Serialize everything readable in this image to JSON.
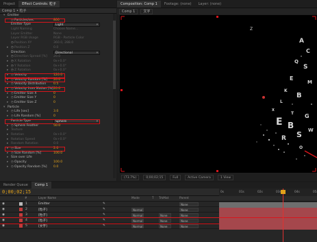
{
  "left_tabs": [
    "Project",
    "Effect Controls: 粒子"
  ],
  "fx_subtitle": "Comp 1 • 粒子",
  "fx_rows": [
    {
      "label": "Emitter",
      "indent": 1,
      "tri": "▾",
      "type": "section"
    },
    {
      "label": "Particles/sec",
      "indent": 2,
      "sw": true,
      "value": "800",
      "vc": "orange",
      "hl": true
    },
    {
      "label": "Emitter Type",
      "indent": 2,
      "value": "Light",
      "vc": "dd"
    },
    {
      "label": "Light Naming",
      "indent": 2,
      "dim": true,
      "value": "Choose Name...",
      "vc": "dim"
    },
    {
      "label": "Layer Emitter",
      "indent": 2,
      "dim": true,
      "value": "None",
      "vc": "dim"
    },
    {
      "label": "Layer RGB Usage",
      "indent": 2,
      "dim": true,
      "value": "RGB - Particle Color",
      "vc": "dim"
    },
    {
      "label": "Position XY",
      "indent": 2,
      "dim": true,
      "sw": true,
      "value": "360.0, 288.0",
      "vc": "dim"
    },
    {
      "label": "Position Z",
      "indent": 2,
      "dim": true,
      "tri": "▸",
      "sw": true,
      "value": "0.0",
      "vc": "dim"
    },
    {
      "label": "Direction",
      "indent": 2,
      "value": "Directional",
      "vc": "dd"
    },
    {
      "label": "Direction Spread [%]",
      "indent": 2,
      "dim": true,
      "tri": "▸",
      "sw": true,
      "value": "20.0",
      "vc": "dim"
    },
    {
      "label": "X Rotation",
      "indent": 2,
      "dim": true,
      "tri": "▸",
      "sw": true,
      "value": "0x+0.0°",
      "vc": "dim"
    },
    {
      "label": "Y Rotation",
      "indent": 2,
      "dim": true,
      "tri": "▸",
      "sw": true,
      "value": "0x+0.0°",
      "vc": "dim"
    },
    {
      "label": "Z Rotation",
      "indent": 2,
      "dim": true,
      "tri": "▸",
      "sw": true,
      "value": "0x+0.0°",
      "vc": "dim"
    },
    {
      "label": "Velocity",
      "indent": 2,
      "tri": "▸",
      "sw": true,
      "value": "120.0",
      "vc": "orange",
      "hl": true
    },
    {
      "label": "Velocity Random [%]",
      "indent": 2,
      "tri": "▸",
      "sw": true,
      "value": "20.0",
      "vc": "orange",
      "hl": true
    },
    {
      "label": "Velocity Distribution",
      "indent": 2,
      "tri": "▸",
      "sw": true,
      "value": "0.5",
      "vc": "orange"
    },
    {
      "label": "Velocity from Motion [%]",
      "indent": 2,
      "tri": "▸",
      "sw": true,
      "value": "20.0",
      "vc": "orange",
      "hl": true
    },
    {
      "label": "Emitter Size X",
      "indent": 2,
      "tri": "▸",
      "sw": true,
      "value": "0",
      "vc": "orange"
    },
    {
      "label": "Emitter Size Y",
      "indent": 2,
      "tri": "▸",
      "sw": true,
      "value": "0",
      "vc": "orange"
    },
    {
      "label": "Emitter Size Z",
      "indent": 2,
      "tri": "▸",
      "sw": true,
      "value": "0",
      "vc": "orange"
    },
    {
      "label": "Particle",
      "indent": 1,
      "tri": "▾",
      "type": "section"
    },
    {
      "label": "Life [sec]",
      "indent": 2,
      "tri": "▸",
      "sw": true,
      "value": "3.0",
      "vc": "orange"
    },
    {
      "label": "Life Random [%]",
      "indent": 2,
      "tri": "▸",
      "sw": true,
      "value": "0",
      "vc": "orange"
    },
    {
      "label": "Particle Type",
      "indent": 2,
      "value": "Sphere",
      "vc": "dd",
      "hl": true
    },
    {
      "label": "Sphere Feather",
      "indent": 2,
      "tri": "▸",
      "sw": true,
      "value": "50.0",
      "vc": "orange"
    },
    {
      "label": "Texture",
      "indent": 2,
      "dim": true,
      "tri": "▸",
      "value": "",
      "vc": "dim"
    },
    {
      "label": "Rotation",
      "indent": 2,
      "dim": true,
      "tri": "▸",
      "value": "0x+0.0°",
      "vc": "dim"
    },
    {
      "label": "Rotation Speed",
      "indent": 2,
      "dim": true,
      "tri": "▸",
      "value": "0x+0.0°",
      "vc": "dim"
    },
    {
      "label": "Random Rotation",
      "indent": 2,
      "dim": true,
      "tri": "▸",
      "value": "0.0",
      "vc": "dim"
    },
    {
      "label": "Size",
      "indent": 2,
      "tri": "▸",
      "sw": true,
      "value": "2.0",
      "vc": "orange",
      "hl": true
    },
    {
      "label": "Size Random [%]",
      "indent": 2,
      "tri": "▸",
      "sw": true,
      "value": "100.0",
      "vc": "orange"
    },
    {
      "label": "Size over Life",
      "indent": 2,
      "tri": "▸",
      "value": "",
      "vc": "dim"
    },
    {
      "label": "Opacity",
      "indent": 2,
      "tri": "▸",
      "sw": true,
      "value": "100.0",
      "vc": "orange"
    },
    {
      "label": "Opacity Random [%]",
      "indent": 2,
      "tri": "▸",
      "sw": true,
      "value": "0.0",
      "vc": "orange"
    }
  ],
  "comp_tabs": [
    "Composition: Comp 1",
    "Footage: (none)",
    "Layer: (none)"
  ],
  "comp_subtabs": [
    "Comp 1",
    "文字"
  ],
  "viewer_bar": {
    "zoom": "(73.7%)",
    "time": "0;00;02;15",
    "resolution": "Full",
    "camera": "Active Camera",
    "view": "1 View"
  },
  "timeline": {
    "tabs": [
      "Render Queue",
      "Comp 1"
    ],
    "timecode": "0;00;02;15",
    "columns": {
      "num": "#",
      "name": "Layer Name",
      "mode": "Mode",
      "t": "T",
      "trkmat": "TrkMat",
      "parent": "Parent"
    },
    "layers": [
      {
        "num": "1",
        "name": "Emitter",
        "mode": "",
        "trkmat": "",
        "parent": "None",
        "color": "#b8b8b8"
      },
      {
        "num": "2",
        "name": "[粒子]",
        "mode": "Normal",
        "trkmat": "",
        "parent": "None",
        "color": "#c23a3a"
      },
      {
        "num": "3",
        "name": "[粒子]",
        "mode": "Normal",
        "trkmat": "None",
        "parent": "None",
        "color": "#c23a3a"
      },
      {
        "num": "4",
        "name": "[粒子]",
        "mode": "Normal",
        "trkmat": "None",
        "parent": "None",
        "color": "#c23a3a"
      },
      {
        "num": "5",
        "name": "[文字]",
        "mode": "Normal",
        "trkmat": "None",
        "parent": "None",
        "color": "#c23a3a"
      }
    ],
    "ruler": [
      "0s",
      "01s",
      "02s",
      "03s",
      "04s",
      "05s"
    ]
  },
  "colors": {
    "accent": "#e3a21a",
    "highlight": "#d8161c",
    "track": "#a5474c"
  }
}
